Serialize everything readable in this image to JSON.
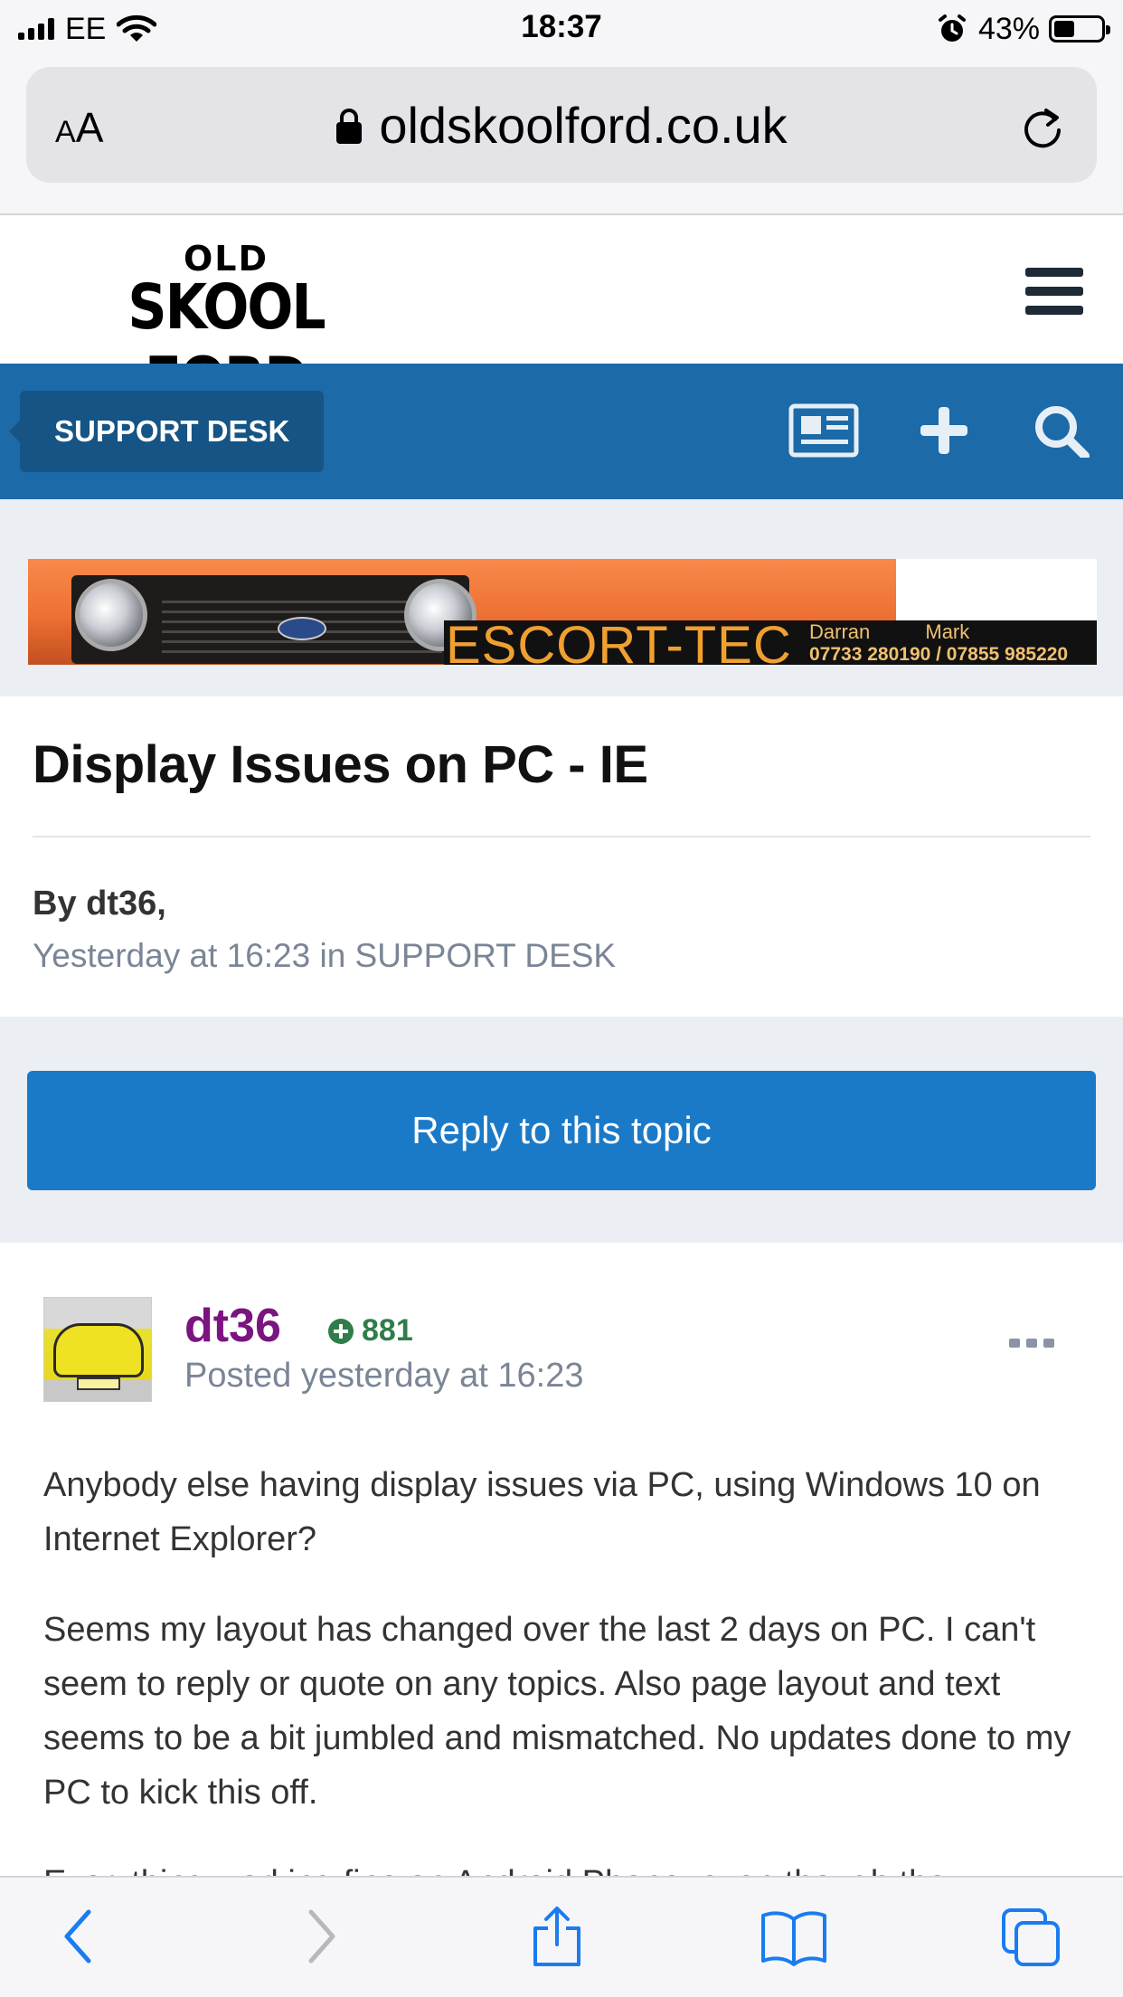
{
  "status_bar": {
    "carrier": "EE",
    "time": "18:37",
    "battery": "43%",
    "battery_level": 0.43
  },
  "browser": {
    "aa_label": "AA",
    "url": "oldskoolford.co.uk"
  },
  "site": {
    "logo_line1": "OLD",
    "logo_line2": "SKOOL FORD"
  },
  "nav": {
    "breadcrumb": "SUPPORT DESK"
  },
  "banner": {
    "title": "ESCORT-TEC",
    "names": "Darran          Mark",
    "phones": "07733 280190 / 07855 985220"
  },
  "topic": {
    "title": "Display Issues on PC - IE",
    "by_line": "By dt36,",
    "meta": "Yesterday at 16:23 in SUPPORT DESK"
  },
  "reply_button": "Reply to this topic",
  "post": {
    "author": "dt36",
    "reputation": "881",
    "posted": "Posted yesterday at 16:23",
    "paragraphs": [
      "Anybody else having display issues via PC, using Windows 10 on Internet Explorer?",
      "Seems my layout has changed over the last 2 days on PC. I can't seem to reply or quote on any topics.  Also page layout and text seems to be a bit jumbled and mismatched.  No updates done to my PC to kick this off.",
      "Everything working fine on Android Phone, even though the"
    ]
  },
  "colors": {
    "nav_blue": "#1c6aa8",
    "crumb_blue": "#155484",
    "button_blue": "#1a7ac8",
    "author_purple": "#7a1480",
    "rep_green": "#2f7d4a",
    "ios_blue": "#1a7cf0"
  },
  "icons": {
    "news": "newspaper-icon",
    "plus": "plus-icon",
    "search": "search-icon",
    "back": "chevron-left-icon",
    "forward": "chevron-right-icon",
    "share": "share-icon",
    "bookmarks": "book-icon",
    "tabs": "tabs-icon"
  }
}
